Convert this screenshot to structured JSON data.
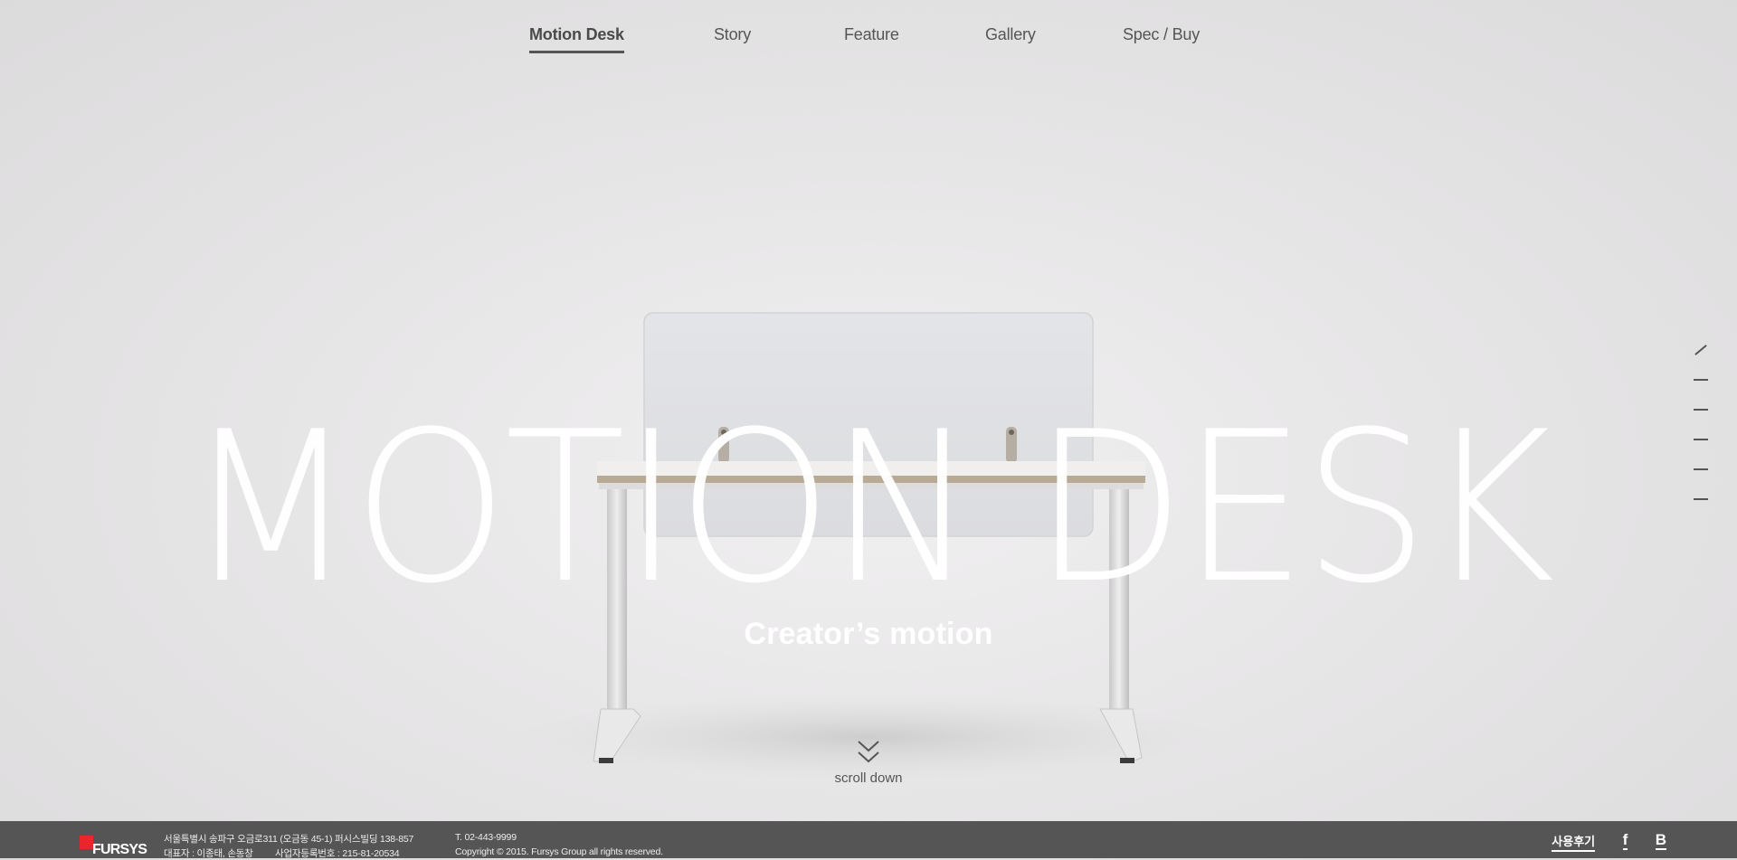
{
  "nav": {
    "items": [
      {
        "label": "Motion Desk",
        "active": true
      },
      {
        "label": "Story"
      },
      {
        "label": "Feature"
      },
      {
        "label": "Gallery"
      },
      {
        "label": "Spec / Buy"
      }
    ]
  },
  "hero": {
    "title": "MOTION DESK",
    "subtitle": "Creator’s motion"
  },
  "scroll": {
    "label": "scroll down",
    "icon": "double-chevron-down-icon"
  },
  "side_nav": {
    "count": 6,
    "active_index": 0
  },
  "footer": {
    "logo_text": "FURSYS",
    "address": "서울특별시 송파구 오금로311 (오금동 45-1) 퍼시스빌딩   138-857",
    "ceo": "대표자 : 이종태, 손동창",
    "biz_no": "사업자등록번호 : 215-81-20534",
    "tel": "T. 02-443-9999",
    "copyright": "Copyright © 2015. Fursys Group all rights reserved.",
    "links": {
      "review": "사용후기",
      "facebook": "f",
      "blog": "B"
    }
  },
  "colors": {
    "background": "#e7e6e7",
    "footer": "#555556",
    "brand_red": "#e8262b",
    "text": "#555555"
  }
}
